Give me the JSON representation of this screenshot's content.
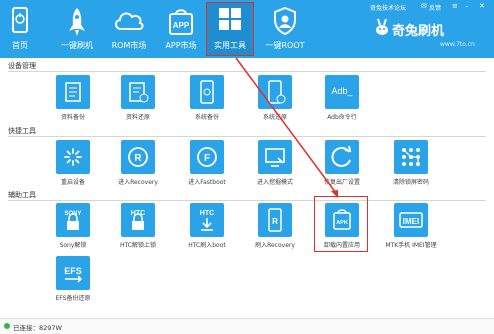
{
  "nav": {
    "items": [
      {
        "label": "首页",
        "icon": "phone-icon"
      },
      {
        "label": "一键刷机",
        "icon": "rocket-icon"
      },
      {
        "label": "ROM市场",
        "icon": "cloud-icon"
      },
      {
        "label": "APP市场",
        "icon": "app-bag-icon"
      },
      {
        "label": "实用工具",
        "icon": "grid-icon"
      },
      {
        "label": "一键ROOT",
        "icon": "shield-icon"
      }
    ],
    "active_index": 4
  },
  "header": {
    "forum_link": "奇兔技术论坛",
    "feedback": "反馈",
    "brand": "奇兔刷机",
    "url": "www.7to.cn"
  },
  "sections": [
    {
      "label": "设备管理",
      "tools": [
        "资料备份",
        "资料还原",
        "系统备份",
        "系统还原",
        "Adb命令行"
      ]
    },
    {
      "label": "快捷工具",
      "tools": [
        "重启设备",
        "进入Recovery",
        "进入Fastboot",
        "进入挖掘模式",
        "恢复出厂设置",
        "清除锁屏密码"
      ]
    },
    {
      "label": "辅助工具",
      "tools": [
        "Sony解锁",
        "HTC解锁上锁",
        "HTC刷入boot",
        "刷入Recovery",
        "卸载内置应用",
        "MTK手机 IMEI管理",
        "EFS备份还原"
      ]
    }
  ],
  "tile_texts": {
    "adb": "Adb_",
    "sony": "SONY",
    "htc": "HTC",
    "apk": "APK",
    "imei": "IMEI",
    "efs": "EFS"
  },
  "status": {
    "text": "已连接：8297W"
  },
  "colors": {
    "accent": "#2aa3e8",
    "highlight": "#e0302b",
    "connected": "#3ab54a"
  }
}
